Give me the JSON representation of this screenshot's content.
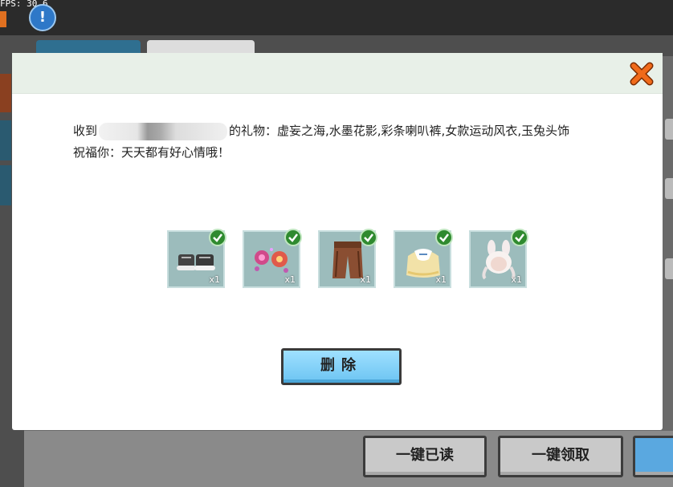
{
  "hud": {
    "fps": "FPS: 30.6",
    "alert_symbol": "!"
  },
  "background": {
    "buttons": {
      "read_all": "一键已读",
      "claim_all": "一键领取"
    }
  },
  "dialog": {
    "message_prefix": "收到",
    "message_suffix": "的礼物：虚妄之海,水墨花影,彩条喇叭裤,女款运动风衣,玉兔头饰",
    "wish": "祝福你：天天都有好心情哦！",
    "items": [
      {
        "icon": "shoes-icon",
        "qty": "x1"
      },
      {
        "icon": "pink-flowers-icon",
        "qty": "x1"
      },
      {
        "icon": "pants-icon",
        "qty": "x1"
      },
      {
        "icon": "jacket-icon",
        "qty": "x1"
      },
      {
        "icon": "rabbit-headwear-icon",
        "qty": "x1"
      }
    ],
    "delete_button": "删除"
  },
  "colors": {
    "accent_orange": "#f06a1a",
    "check_green": "#2f8a2f",
    "button_blue": "#6cc4f2"
  }
}
